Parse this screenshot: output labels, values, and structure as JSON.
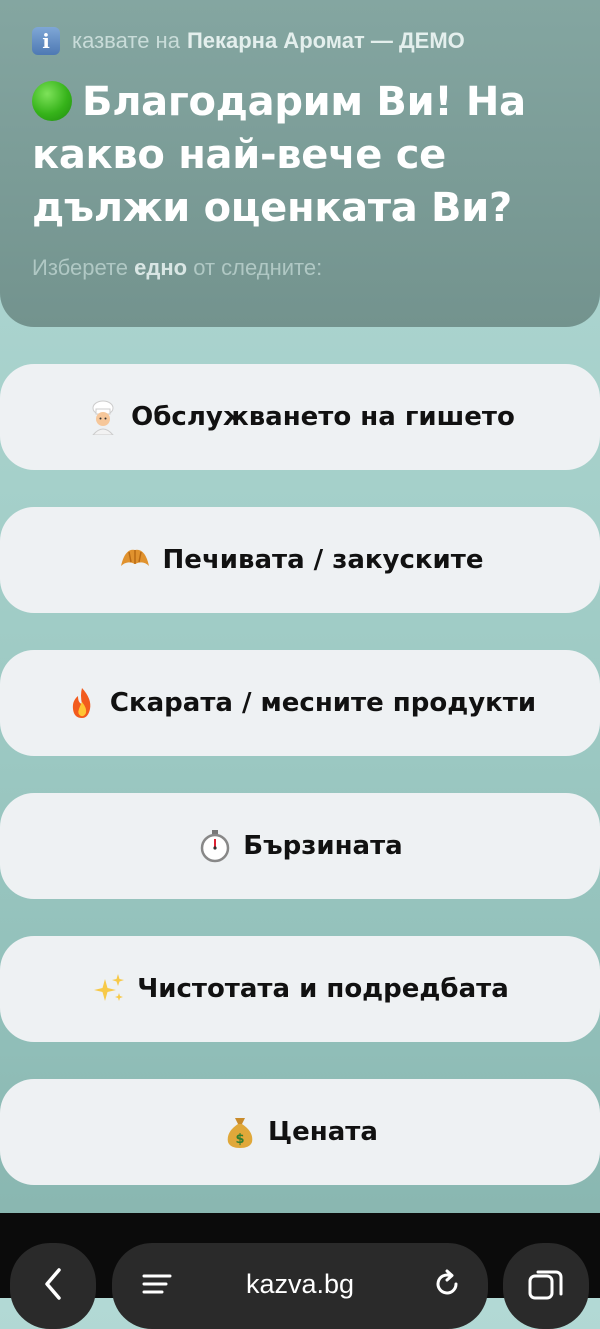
{
  "header": {
    "info_icon": "info-icon",
    "prefix": "казвате на",
    "business": "Пекарна Аромат — ДЕМО",
    "title": "Благодарим Ви! На какво най-вече се дължи оценката Ви?",
    "title_icon": "green-circle-icon",
    "subtitle_before": "Изберете",
    "subtitle_bold": "едно",
    "subtitle_after": "от следните:"
  },
  "options": [
    {
      "icon": "cook-icon",
      "label": "Обслужването на гишето"
    },
    {
      "icon": "croissant-icon",
      "label": "Печивата / закуските"
    },
    {
      "icon": "fire-icon",
      "label": "Скарата / месните продукти"
    },
    {
      "icon": "stopwatch-icon",
      "label": "Бързината"
    },
    {
      "icon": "sparkles-icon",
      "label": "Чистотата и подредбата"
    },
    {
      "icon": "money-bag-icon",
      "label": "Цената"
    }
  ],
  "browser": {
    "url": "kazva.bg",
    "back_icon": "back-arrow-icon",
    "menu_icon": "menu-icon",
    "reload_icon": "reload-icon",
    "tabs_icon": "tabs-icon"
  },
  "colors": {
    "header_bg": "#7a9b96",
    "page_bg": "#a4cfc9",
    "option_bg": "#eef1f3"
  }
}
